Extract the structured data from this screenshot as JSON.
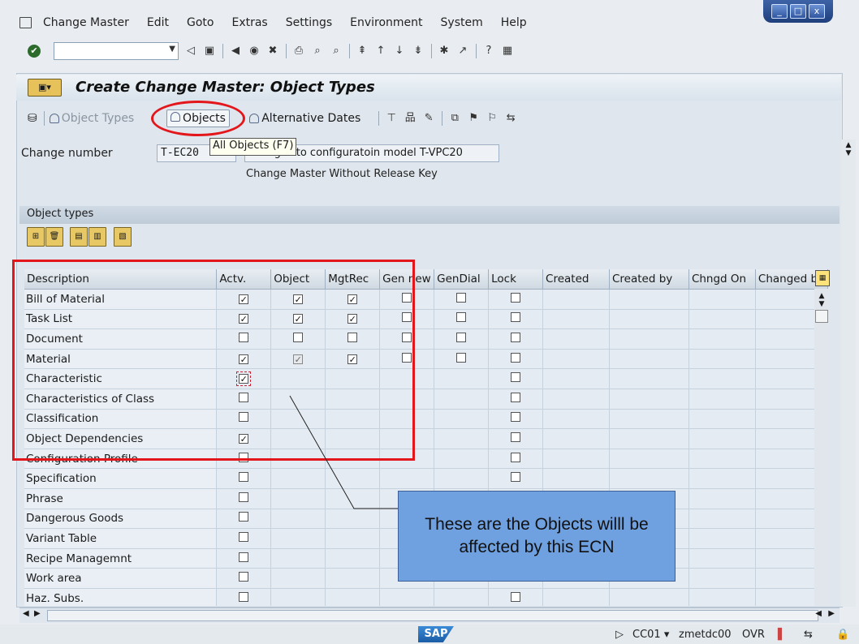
{
  "menu": [
    "Change Master",
    "Edit",
    "Goto",
    "Extras",
    "Settings",
    "Environment",
    "System",
    "Help"
  ],
  "window_controls": [
    "_",
    "□",
    "x"
  ],
  "title": "Create Change Master: Object Types",
  "app_toolbar": {
    "object_types": "Object Types",
    "objects": "Objects",
    "alternative_dates": "Alternative Dates"
  },
  "tooltip": "All Objects   (F7)",
  "change_number": {
    "label": "Change number",
    "value": "T-EC20",
    "description": "changes to configuratoin model T-VPC20",
    "note": "Change Master Without Release Key"
  },
  "object_types_label": "Object types",
  "table": {
    "columns": [
      "Description",
      "Actv.",
      "Object",
      "MgtRec",
      "Gen new",
      "GenDial",
      "Lock",
      "Created",
      "Created by",
      "Chngd On",
      "Changed by"
    ],
    "rows": [
      {
        "desc": "Bill of Material",
        "c": [
          1,
          1,
          1,
          0,
          0,
          0
        ]
      },
      {
        "desc": "Task List",
        "c": [
          1,
          1,
          1,
          0,
          0,
          0
        ]
      },
      {
        "desc": "Document",
        "c": [
          0,
          0,
          0,
          0,
          0,
          0
        ]
      },
      {
        "desc": "Material",
        "c": [
          1,
          "g",
          1,
          0,
          0,
          0
        ]
      },
      {
        "desc": "Characteristic",
        "c": [
          "f",
          null,
          null,
          null,
          null,
          0
        ]
      },
      {
        "desc": "Characteristics of Class",
        "c": [
          0,
          null,
          null,
          null,
          null,
          0
        ]
      },
      {
        "desc": "Classification",
        "c": [
          0,
          null,
          null,
          null,
          null,
          0
        ]
      },
      {
        "desc": "Object Dependencies",
        "c": [
          1,
          null,
          null,
          null,
          null,
          0
        ]
      },
      {
        "desc": "Configuration Profile",
        "c": [
          0,
          null,
          null,
          null,
          null,
          0
        ]
      },
      {
        "desc": "Specification",
        "c": [
          0,
          null,
          null,
          null,
          null,
          0
        ]
      },
      {
        "desc": "Phrase",
        "c": [
          0,
          null,
          null,
          null,
          null,
          null
        ]
      },
      {
        "desc": "Dangerous Goods",
        "c": [
          0,
          null,
          null,
          null,
          null,
          null
        ]
      },
      {
        "desc": "Variant Table",
        "c": [
          0,
          null,
          null,
          null,
          null,
          null
        ]
      },
      {
        "desc": "Recipe Managemnt",
        "c": [
          0,
          null,
          null,
          null,
          null,
          null
        ]
      },
      {
        "desc": "Work area",
        "c": [
          0,
          null,
          null,
          null,
          null,
          null
        ]
      },
      {
        "desc": "Haz. Subs.",
        "c": [
          0,
          null,
          null,
          null,
          null,
          0
        ]
      }
    ]
  },
  "callout": "These are the Objects willl be affected by this ECN",
  "status": {
    "logo": "SAP",
    "system": "CC01",
    "server": "zmetdc00",
    "mode": "OVR"
  },
  "colors": {
    "annotation_red": "#e3161b",
    "callout_blue": "#6fa0e0"
  }
}
